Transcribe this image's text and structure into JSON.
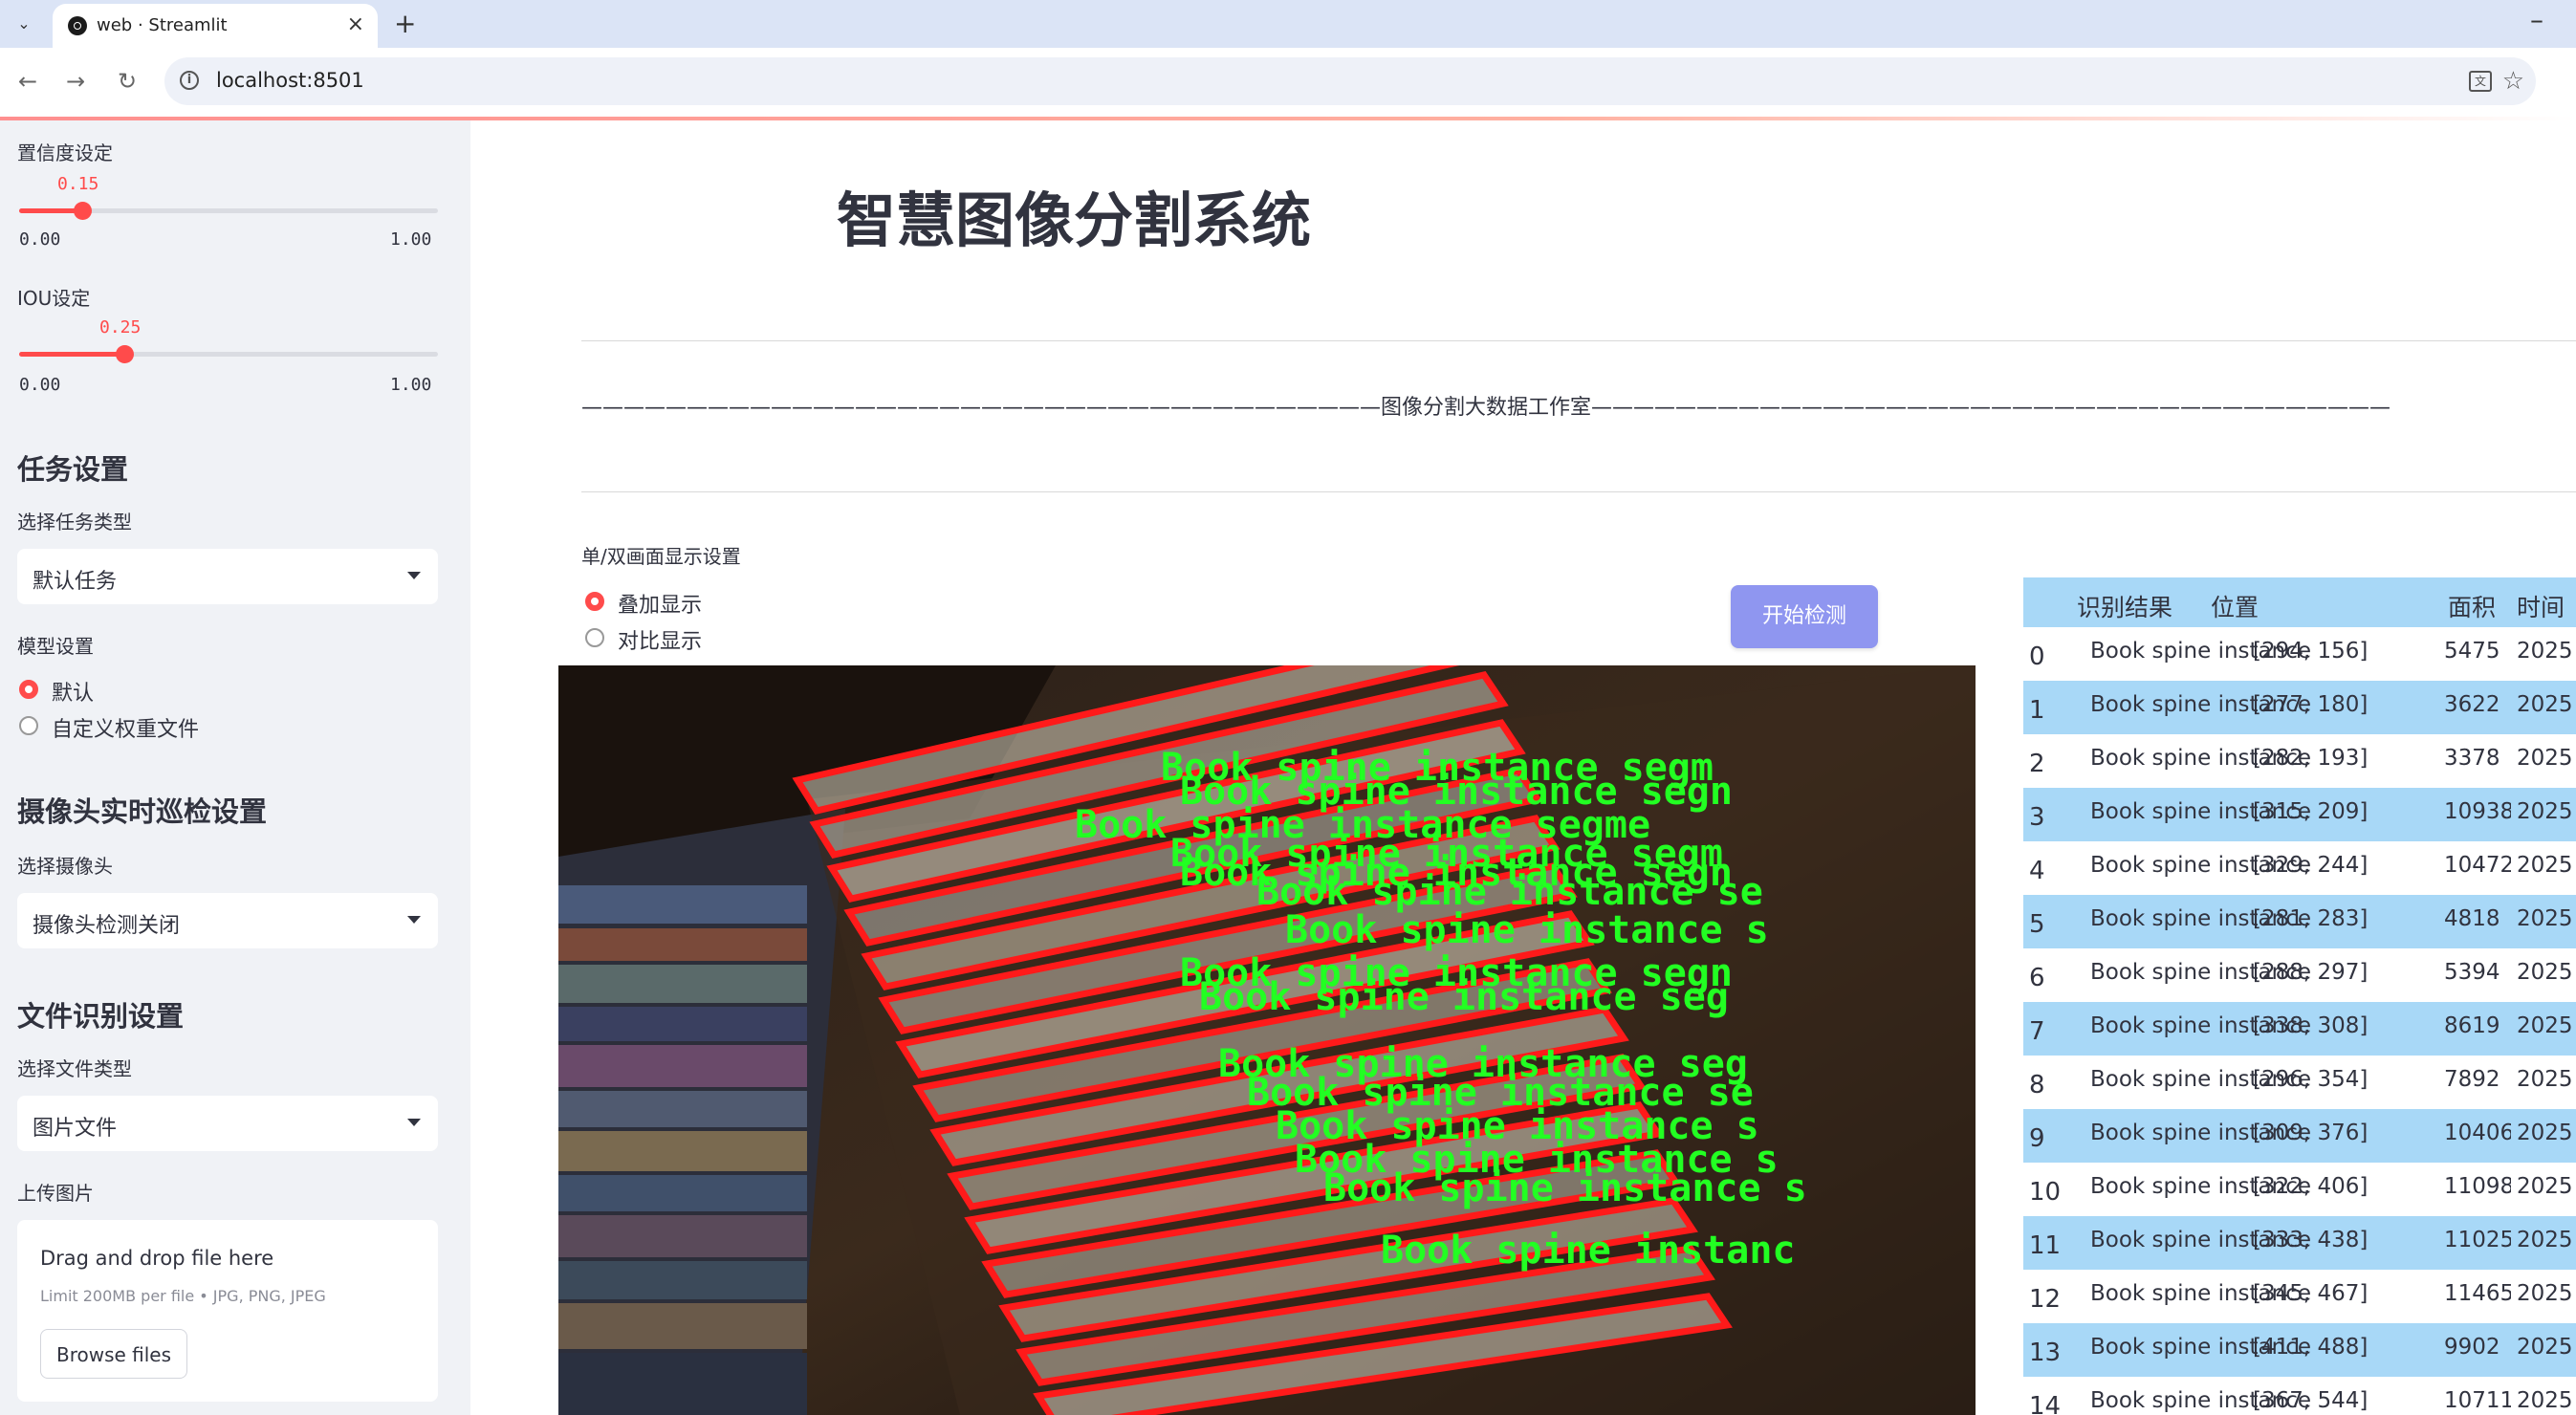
{
  "browser": {
    "tab_title": "web · Streamlit",
    "url": "localhost:8501",
    "icons": [
      "tab-dropdown-icon",
      "streamlit-favicon",
      "close-icon",
      "plus-icon",
      "minimize-icon",
      "back-icon",
      "forward-icon",
      "reload-icon",
      "info-icon",
      "translate-icon",
      "star-icon"
    ]
  },
  "sidebar": {
    "confidence": {
      "label": "置信度设定",
      "value": "0.15",
      "min": "0.00",
      "max": "1.00",
      "fraction": 0.15
    },
    "iou": {
      "label": "IOU设定",
      "value": "0.25",
      "min": "0.00",
      "max": "1.00",
      "fraction": 0.25
    },
    "task_header": "任务设置",
    "task_type_label": "选择任务类型",
    "task_type_value": "默认任务",
    "model_label": "模型设置",
    "model_options": [
      {
        "label": "默认",
        "selected": true
      },
      {
        "label": "自定义权重文件",
        "selected": false
      }
    ],
    "camera_header": "摄像头实时巡检设置",
    "camera_label": "选择摄像头",
    "camera_value": "摄像头检测关闭",
    "file_header": "文件识别设置",
    "file_type_label": "选择文件类型",
    "file_type_value": "图片文件",
    "upload_label": "上传图片",
    "upload_title": "Drag and drop file here",
    "upload_limit": "Limit 200MB per file • JPG, PNG, JPEG",
    "browse_label": "Browse files"
  },
  "main": {
    "title": "智慧图像分割系统",
    "studio": "——————————————————————————————————————图像分割大数据工作室——————————————————————————————————————",
    "display_label": "单/双画面显示设置",
    "display_options": [
      {
        "label": "叠加显示",
        "selected": true
      },
      {
        "label": "对比显示",
        "selected": false
      }
    ],
    "start_button": "开始检测",
    "detection_label": "Book spine instance segmentation",
    "detection_texts": [
      "Book spine instance segm",
      "Book spine instance segn",
      "Book spine instance segme",
      "Book spine instance segm",
      "Book spine instance segn",
      "Book spine instance se",
      "Book spine instance s",
      "Book spine instance segn",
      "Book spine instance seg",
      "Book spine instance seg",
      "Book spine instance se",
      "Book spine instance s",
      "Book spine instance s",
      "Book spine instance s",
      "Book spine instanc"
    ]
  },
  "table": {
    "columns": [
      "识别结果",
      "位置",
      "面积",
      "时间"
    ],
    "rows": [
      {
        "idx": "0",
        "result": "Book spine instance segmentation",
        "pos": "[294, 156]",
        "area": "5475",
        "time": "2025"
      },
      {
        "idx": "1",
        "result": "Book spine instance segmentation",
        "pos": "[277, 180]",
        "area": "3622",
        "time": "2025"
      },
      {
        "idx": "2",
        "result": "Book spine instance segmentation",
        "pos": "[282, 193]",
        "area": "3378",
        "time": "2025"
      },
      {
        "idx": "3",
        "result": "Book spine instance segmentation",
        "pos": "[315, 209]",
        "area": "10938",
        "time": "2025"
      },
      {
        "idx": "4",
        "result": "Book spine instance segmentation",
        "pos": "[329, 244]",
        "area": "10472",
        "time": "2025"
      },
      {
        "idx": "5",
        "result": "Book spine instance segmentation",
        "pos": "[281, 283]",
        "area": "4818",
        "time": "2025"
      },
      {
        "idx": "6",
        "result": "Book spine instance segmentation",
        "pos": "[288, 297]",
        "area": "5394",
        "time": "2025"
      },
      {
        "idx": "7",
        "result": "Book spine instance segmentation",
        "pos": "[338, 308]",
        "area": "8619",
        "time": "2025"
      },
      {
        "idx": "8",
        "result": "Book spine instance segmentation",
        "pos": "[296, 354]",
        "area": "7892",
        "time": "2025"
      },
      {
        "idx": "9",
        "result": "Book spine instance segmentation",
        "pos": "[309, 376]",
        "area": "10406",
        "time": "2025"
      },
      {
        "idx": "10",
        "result": "Book spine instance segmentation",
        "pos": "[322, 406]",
        "area": "11098",
        "time": "2025"
      },
      {
        "idx": "11",
        "result": "Book spine instance segmentation",
        "pos": "[333, 438]",
        "area": "11025",
        "time": "2025"
      },
      {
        "idx": "12",
        "result": "Book spine instance segmentation",
        "pos": "[345, 467]",
        "area": "11465",
        "time": "2025"
      },
      {
        "idx": "13",
        "result": "Book spine instance segmentation",
        "pos": "[411, 488]",
        "area": "9902",
        "time": "2025"
      },
      {
        "idx": "14",
        "result": "Book spine instance segmentation",
        "pos": "[367, 544]",
        "area": "10711",
        "time": "2025"
      }
    ]
  },
  "colors": {
    "accent": "#ff4b4b",
    "button": "#8f96f0",
    "table_stripe": "#a8d8f7",
    "sidebar_bg": "#f0f2f6",
    "mask_outline": "#ff1a1a",
    "label_text": "#22ff22"
  }
}
